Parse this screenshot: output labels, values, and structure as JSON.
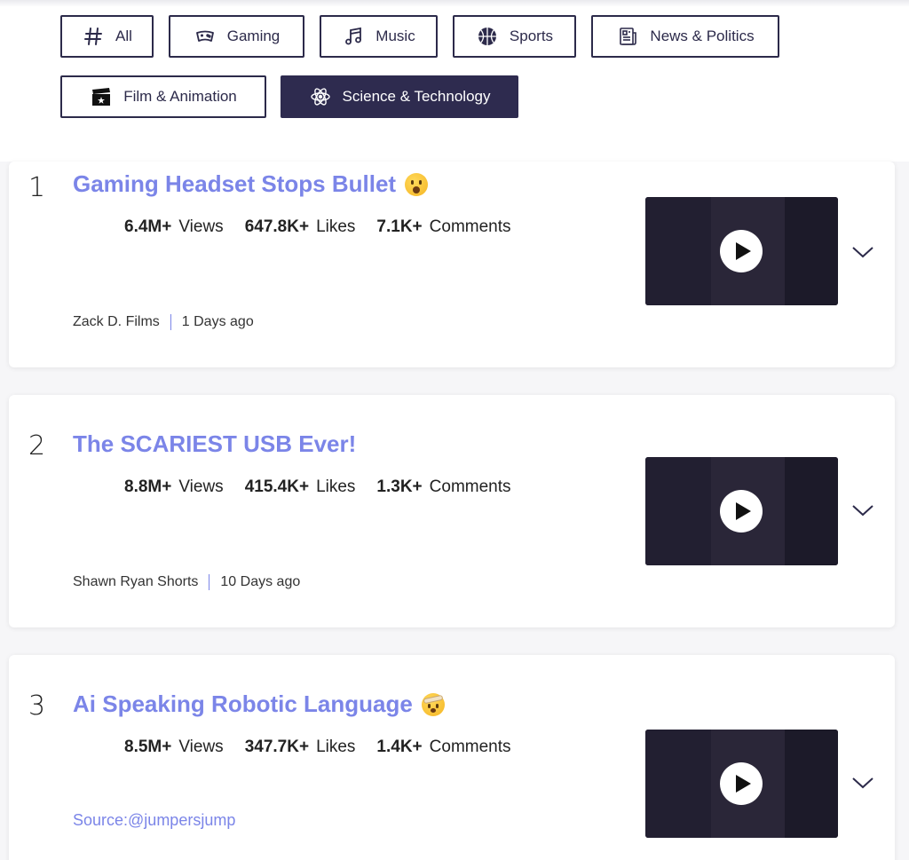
{
  "filters": [
    {
      "label": "All",
      "icon": "hashtag-icon",
      "active": false
    },
    {
      "label": "Gaming",
      "icon": "gamepad-icon",
      "active": false
    },
    {
      "label": "Music",
      "icon": "music-note-icon",
      "active": false
    },
    {
      "label": "Sports",
      "icon": "basketball-icon",
      "active": false
    },
    {
      "label": "News & Politics",
      "icon": "newspaper-icon",
      "active": false
    },
    {
      "label": "Film & Animation",
      "icon": "clapperboard-icon",
      "active": false
    },
    {
      "label": "Science & Technology",
      "icon": "atom-icon",
      "active": true
    }
  ],
  "videos": [
    {
      "rank": "1",
      "title": "Gaming Headset Stops Bullet",
      "emoji": "astonished-face-icon",
      "views": "6.4M+",
      "views_label": "Views",
      "likes": "647.8K+",
      "likes_label": "Likes",
      "comments": "7.1K+",
      "comments_label": "Comments",
      "channel": "Zack D. Films",
      "age": "1 Days ago"
    },
    {
      "rank": "2",
      "title": "The SCARIEST USB Ever!",
      "views": "8.8M+",
      "views_label": "Views",
      "likes": "415.4K+",
      "likes_label": "Likes",
      "comments": "1.3K+",
      "comments_label": "Comments",
      "channel": "Shawn Ryan Shorts",
      "age": "10 Days ago"
    },
    {
      "rank": "3",
      "title": "Ai Speaking Robotic Language",
      "emoji": "exploding-head-icon",
      "views": "8.5M+",
      "views_label": "Views",
      "likes": "347.7K+",
      "likes_label": "Likes",
      "comments": "1.4K+",
      "comments_label": "Comments",
      "source": "Source:@jumpersjump"
    }
  ],
  "colors": {
    "accent": "#7b85e8",
    "active_chip": "#2e2b4f",
    "chip_border": "#2c2a4a"
  }
}
